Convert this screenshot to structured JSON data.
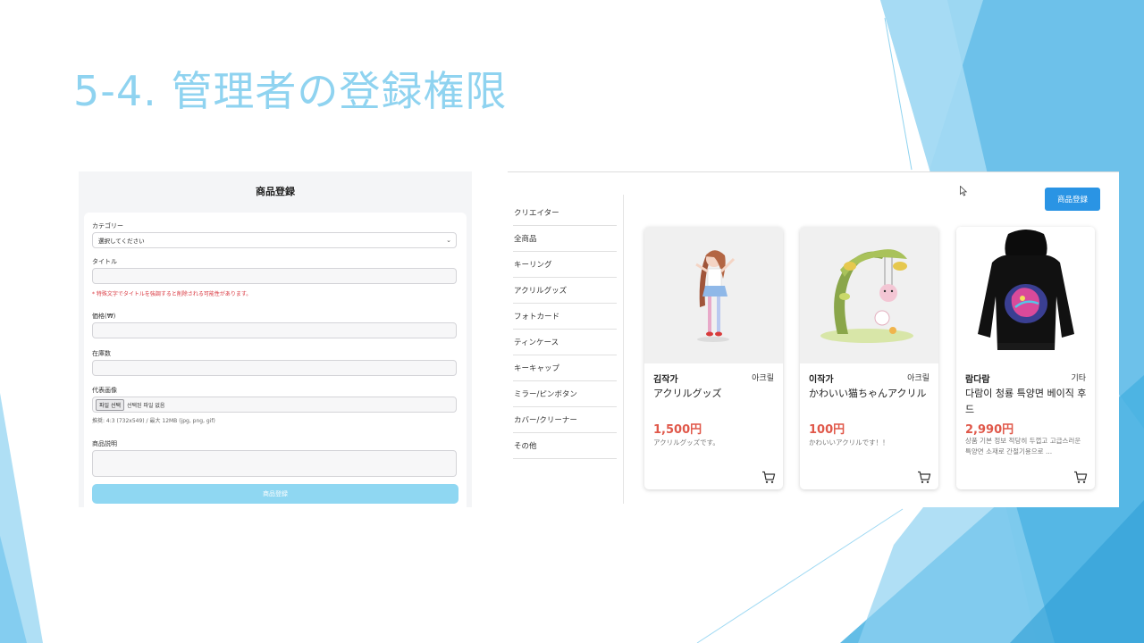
{
  "slide": {
    "title": "5-4. 管理者の登録権限"
  },
  "form": {
    "header": "商品登録",
    "category_label": "カテゴリー",
    "category_value": "選択してください",
    "title_label": "タイトル",
    "title_warning": "* 特殊文字でタイトルを強調すると削除される可能性があります。",
    "price_label": "価格(₩)",
    "stock_label": "在庫数",
    "image_label": "代表画像",
    "file_button": "파일 선택",
    "file_status": "선택된 파일 없음",
    "image_hint": "推奨: 4:3 (732x549) / 最大 12MB (jpg, png, gif)",
    "desc_label": "商品説明",
    "submit_label": "商品登録"
  },
  "shop": {
    "register_button": "商品登録",
    "sidebar": [
      "クリエイター",
      "全商品",
      "キーリング",
      "アクリルグッズ",
      "フォトカード",
      "ティンケース",
      "キーキャップ",
      "ミラー/ピンボタン",
      "カバー/クリーナー",
      "その他"
    ],
    "products": [
      {
        "artist": "김작가",
        "category": "아크릴",
        "name": "アクリルグッズ",
        "price": "1,500円",
        "desc": "アクリルグッズです。"
      },
      {
        "artist": "이작가",
        "category": "아크릴",
        "name": "かわいい猫ちゃんアクリル",
        "price": "100円",
        "desc": "かわいいアクリルです！！"
      },
      {
        "artist": "람다람",
        "category": "기타",
        "name": "다람이 청룡 특양면 베이직 후드",
        "price": "2,990円",
        "desc": "상품 기본 정보 적당히 두껍고 고급스러운 특양면 소재로 간절기용으로 ..."
      }
    ]
  },
  "colors": {
    "accent": "#2a94e4",
    "price": "#e0584a",
    "title": "#8fd3f0",
    "submit": "#8fd7f2"
  },
  "icons": {
    "cart": "cart-icon",
    "cursor": "mouse-cursor-icon"
  }
}
